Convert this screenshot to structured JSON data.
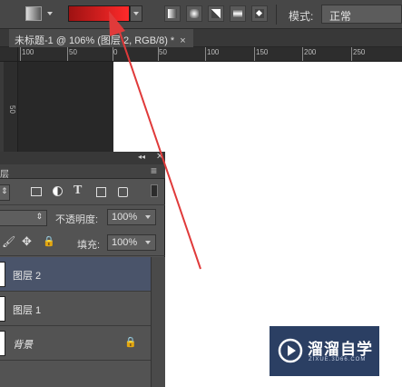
{
  "options_bar": {
    "mode_label": "模式:",
    "mode_value": "正常",
    "gradient_color_start": "#9e1212",
    "gradient_color_end": "#ff2a2a",
    "buttons": [
      "tool-preset-icon",
      "linear-gradient-icon",
      "radial-gradient-icon",
      "angle-gradient-icon",
      "reflected-gradient-icon",
      "diamond-gradient-icon"
    ]
  },
  "document": {
    "tab_title": "未标题-1 @ 106% (图层 2, RGB/8) *",
    "close_glyph": "×"
  },
  "ruler": {
    "h_labels": [
      "100",
      "50",
      "0",
      "50",
      "100",
      "150",
      "200",
      "250"
    ],
    "v_label": "50"
  },
  "layers_panel": {
    "collapse_glyph": "◂◂",
    "menu_glyph": "≡",
    "tab_fragment": "层",
    "filter_icons": [
      "image-filter-icon",
      "adjustment-filter-icon",
      "type-filter-icon",
      "shape-filter-icon",
      "smart-object-filter-icon"
    ],
    "opacity_label": "不透明度:",
    "opacity_value": "100%",
    "fill_label": "填充:",
    "fill_value": "100%",
    "layers": [
      {
        "name": "图层 2",
        "selected": true
      },
      {
        "name": "图层 1",
        "selected": false
      },
      {
        "name": "背景",
        "selected": false,
        "locked": true
      }
    ]
  },
  "colors": {
    "selected_layer_bg": "#4a546a",
    "annotation_arrow": "#e03a3a"
  },
  "watermark": {
    "title": "溜溜自学",
    "subtitle": "ZIXUE.3D66.COM"
  }
}
